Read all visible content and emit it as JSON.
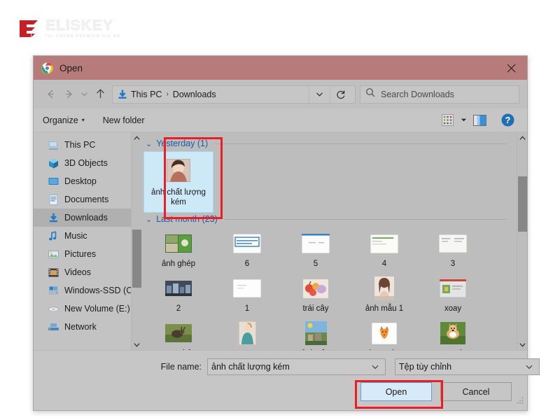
{
  "watermark": {
    "word": "ELISKEY",
    "tagline": "TAI KHOAN PREMIUM GIA RE",
    "brand_color": "#c62026"
  },
  "dialog": {
    "titlebar": {
      "title": "Open",
      "app_icon": "chrome-icon",
      "close_icon": "close-icon",
      "bg_color": "#b87b7b"
    },
    "nav": {
      "back_icon": "arrow-left-icon",
      "forward_icon": "arrow-right-icon",
      "recent_icon": "chevron-down-icon",
      "up_icon": "arrow-up-icon",
      "address_icon": "downloads-folder-icon",
      "breadcrumbs": [
        "This PC",
        "Downloads"
      ],
      "separator": "›",
      "dropdown_icon": "chevron-down-icon",
      "refresh_icon": "refresh-icon",
      "search": {
        "icon": "search-icon",
        "placeholder": "Search Downloads",
        "value": ""
      }
    },
    "commandbar": {
      "organize_label": "Organize",
      "organize_caret": "▾",
      "new_folder_label": "New folder",
      "view_icon": "view-options-icon",
      "view_caret_icon": "chevron-down-icon",
      "preview_pane_icon": "preview-pane-icon",
      "help_icon": "help-icon",
      "help_glyph": "?"
    },
    "sidebar": {
      "items": [
        {
          "label": "This PC",
          "icon": "this-pc-icon",
          "selected": false
        },
        {
          "label": "3D Objects",
          "icon": "3d-objects-icon",
          "selected": false
        },
        {
          "label": "Desktop",
          "icon": "desktop-icon",
          "selected": false
        },
        {
          "label": "Documents",
          "icon": "documents-icon",
          "selected": false
        },
        {
          "label": "Downloads",
          "icon": "downloads-icon",
          "selected": true
        },
        {
          "label": "Music",
          "icon": "music-icon",
          "selected": false
        },
        {
          "label": "Pictures",
          "icon": "pictures-icon",
          "selected": false
        },
        {
          "label": "Videos",
          "icon": "videos-icon",
          "selected": false
        },
        {
          "label": "Windows-SSD (C:",
          "icon": "drive-icon",
          "selected": false
        },
        {
          "label": "New Volume (E:)",
          "icon": "disk-icon",
          "selected": false
        },
        {
          "label": "Network",
          "icon": "network-icon",
          "selected": false
        }
      ],
      "scrollbar": {
        "up_icon": "scroll-up-icon",
        "down_icon": "scroll-down-icon"
      }
    },
    "filepane": {
      "groups": [
        {
          "header": "Yesterday (1)",
          "chevron": "⌄",
          "rows": [
            [
              {
                "label": "ảnh chất lượng kém",
                "thumb": "photo-portrait",
                "selected": true
              }
            ]
          ]
        },
        {
          "header": "Last month (23)",
          "chevron": "⌄",
          "rows": [
            [
              {
                "label": "ảnh ghép",
                "thumb": "photo-collage",
                "selected": false
              },
              {
                "label": "6",
                "thumb": "doc-blue",
                "selected": false
              },
              {
                "label": "5",
                "thumb": "doc-plain",
                "selected": false
              },
              {
                "label": "4",
                "thumb": "doc-green",
                "selected": false
              },
              {
                "label": "3",
                "thumb": "doc-grey",
                "selected": false
              }
            ],
            [
              {
                "label": "2",
                "thumb": "photo-city",
                "selected": false
              },
              {
                "label": "1",
                "thumb": "doc-white",
                "selected": false
              },
              {
                "label": "trái cây",
                "thumb": "photo-fruit",
                "selected": false
              },
              {
                "label": "ảnh mẫu 1",
                "thumb": "photo-model",
                "selected": false
              },
              {
                "label": "xoay",
                "thumb": "photo-card",
                "selected": false
              }
            ],
            [
              {
                "label": "con thỏ",
                "thumb": "photo-rabbit",
                "selected": false
              },
              {
                "label": "rose",
                "thumb": "photo-rose",
                "selected": false
              },
              {
                "label": "ảnh cận",
                "thumb": "photo-landscape",
                "selected": false
              },
              {
                "label": "logo cáo",
                "thumb": "logo-fox",
                "selected": false
              },
              {
                "label": "corgi",
                "thumb": "photo-corgi",
                "selected": false
              }
            ]
          ]
        }
      ],
      "scrollbar": {
        "up_icon": "scroll-up-icon",
        "down_icon": "scroll-down-icon"
      }
    },
    "footer": {
      "filename_label": "File name:",
      "filename_value": "ảnh chất lượng kém",
      "filename_caret_icon": "chevron-down-icon",
      "filetype_value": "Tệp tùy chỉnh",
      "filetype_caret_icon": "chevron-down-icon",
      "open_label": "Open",
      "cancel_label": "Cancel",
      "resize_grip": "resize-grip-icon"
    }
  },
  "annotations": {
    "highlight_color": "#ee1c25",
    "boxes": [
      {
        "name": "selected-file-highlight"
      },
      {
        "name": "open-button-highlight"
      }
    ]
  }
}
